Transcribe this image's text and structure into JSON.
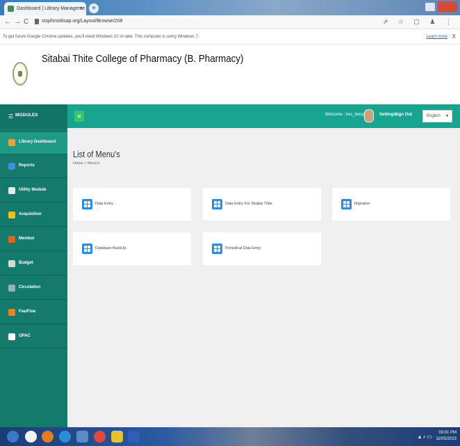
{
  "browser": {
    "tab_title": "Dashboard | Library Manageme",
    "tab_close": "x",
    "new_tab": "+",
    "back": "←",
    "forward": "→",
    "reload": "C",
    "url": "stsphinstitsap.org/Layout/Browse/208",
    "address_icons": "⇗ ☆ ▢ ♟ ⋮"
  },
  "infobar": {
    "message": "To get future Google Chrome updates, you'll need Windows 10 or later. This computer is using Windows 7.",
    "learn_more": "Learn more",
    "close": "X"
  },
  "header": {
    "college_name": "Sitabai Thite College of Pharmacy (B. Pharmacy)"
  },
  "topnav": {
    "modules_icon": "☰",
    "modules_label": "MODULES",
    "hamburger": "≡",
    "welcome": "Welcome : lms_bstcp",
    "settings": "Settings",
    "sign_out": "Sign Out",
    "language": "English",
    "language_caret": "▾"
  },
  "sidebar": {
    "items": [
      {
        "label": "Library Dashboard",
        "icon": "dashboard-icon",
        "color": "#f0a030"
      },
      {
        "label": "Reports",
        "icon": "reports-icon",
        "color": "#3a8fe0"
      },
      {
        "label": "Utility Module",
        "icon": "utility-icon",
        "color": "#e8e8e8"
      },
      {
        "label": "Acquisition",
        "icon": "acquisition-icon",
        "color": "#e8c020"
      },
      {
        "label": "Member",
        "icon": "member-icon",
        "color": "#e86020"
      },
      {
        "label": "Budget",
        "icon": "budget-icon",
        "color": "#d8d8d8"
      },
      {
        "label": "Circulation",
        "icon": "circulation-icon",
        "color": "#9ab0c0"
      },
      {
        "label": "Fee/Fine",
        "icon": "fee-icon",
        "color": "#f08020"
      },
      {
        "label": "OPAC",
        "icon": "opac-icon",
        "color": "#ffffff"
      }
    ]
  },
  "main": {
    "title": "List of Menu's",
    "breadcrumb": "Home > Menu's",
    "cards": [
      {
        "label": "Data Entry"
      },
      {
        "label": "Data Entry For Sitabai Thite"
      },
      {
        "label": "Migration"
      },
      {
        "label": "Database BackUp"
      },
      {
        "label": "Periodical Data Entry"
      }
    ]
  },
  "taskbar": {
    "tray": "▴ ♪ ▭",
    "time": "03:01 PM",
    "date": "11/05/2023"
  }
}
